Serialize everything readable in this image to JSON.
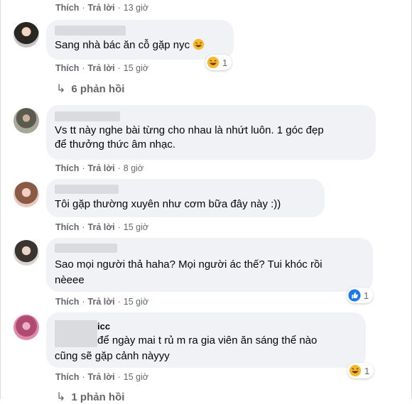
{
  "actions": {
    "like": "Thích",
    "reply": "Trả lời",
    "separator": "·"
  },
  "top_meta": {
    "time": "13 giờ"
  },
  "comments": [
    {
      "text_lines": [
        "Sang nhà bác ăn cỗ gặp nyc"
      ],
      "time": "15 giờ",
      "reaction": {
        "icon": "haha-emoji",
        "count": "1"
      }
    },
    {
      "text_lines": [
        "Vs tt này nghe bài từng cho nhau là nhứt luôn. 1 góc đẹp",
        "để thưởng thức âm nhạc."
      ],
      "time": "8 giờ"
    },
    {
      "text_lines": [
        "Tôi gặp thường xuyên như cơm bữa đây này :))"
      ],
      "time": "15 giờ"
    },
    {
      "text_lines": [
        "Sao mọi người thả haha? Mọi người ác thế? Tui khóc rồi",
        "nèeee"
      ],
      "time": "15 giờ",
      "reaction": {
        "icon": "like-thumb",
        "count": "1"
      }
    },
    {
      "name_fragment": "icc",
      "text_lines": [
        "để ngày mai t rủ m ra gia viên ăn sáng thể nào",
        "cũng sẽ gặp cảnh nàyyy"
      ],
      "time": "15 giờ",
      "reaction": {
        "icon": "haha-emoji",
        "count": "1"
      }
    }
  ],
  "reply_links": [
    "6 phản hồi",
    "1 phản hồi"
  ],
  "colors": {
    "bubble": "#f0f2f5",
    "meta": "#65676b",
    "text": "#050505",
    "like_blue": "#1877f2",
    "haha_yellow": "#f7b928"
  }
}
